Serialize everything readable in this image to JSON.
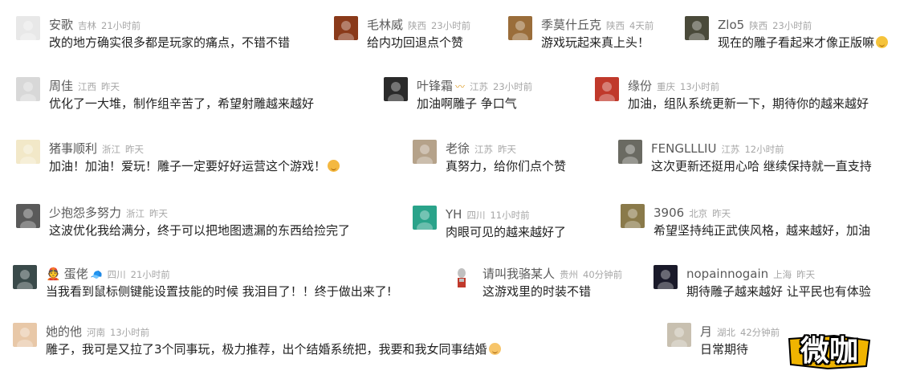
{
  "comments": [
    {
      "name": "安歌",
      "region": "吉林",
      "time": "21小时前",
      "text": "改的地方确实很多都是玩家的痛点，不错不错",
      "avatar_color": "#e8e8e8",
      "avatar_icon": "user-photo-icon"
    },
    {
      "name": "毛林威",
      "region": "陕西",
      "time": "23小时前",
      "text": "给内功回退点个赞",
      "avatar_color": "#8a3a1a",
      "avatar_icon": "user-photo-icon"
    },
    {
      "name": "季莫什丘克",
      "region": "陕西",
      "time": "4天前",
      "text": "游戏玩起来真上头！",
      "avatar_color": "#9a6d3a",
      "avatar_icon": "user-photo-icon"
    },
    {
      "name": "Zlo5",
      "region": "陕西",
      "time": "23小时前",
      "text": "现在的雕子看起来才像正版嘛",
      "avatar_color": "#4a4a3a",
      "avatar_icon": "user-photo-icon",
      "emoji": "wink-emoji-icon"
    },
    {
      "name": "周佳",
      "region": "江西",
      "time": "昨天",
      "text": "优化了一大堆，制作组辛苦了，希望射雕越来越好",
      "avatar_color": "#d8d8d8",
      "avatar_icon": "user-photo-icon"
    },
    {
      "name": "叶锋霜",
      "region": "江苏",
      "time": "23小时前",
      "text": "加油啊雕子 争口气",
      "avatar_color": "#2a2a2a",
      "avatar_icon": "user-photo-icon",
      "badge": "〰"
    },
    {
      "name": "缘份",
      "region": "重庆",
      "time": "13小时前",
      "text": "加油，组队系统更新一下，期待你的越来越好",
      "avatar_color": "#c0392b",
      "avatar_icon": "user-photo-icon"
    },
    {
      "name": "猪事顺利",
      "region": "浙江",
      "time": "昨天",
      "text": "加油！加油！爱玩！雕子一定要好好运营这个游戏！",
      "avatar_color": "#f2e8c8",
      "avatar_icon": "user-photo-icon",
      "emoji": "happy-emoji-icon"
    },
    {
      "name": "老徐",
      "region": "江苏",
      "time": "昨天",
      "text": "真努力，给你们点个赞",
      "avatar_color": "#b5a28a",
      "avatar_icon": "user-photo-icon"
    },
    {
      "name": "FENGLLLIU",
      "region": "江苏",
      "time": "12小时前",
      "text": "这次更新还挺用心哈 继续保持就一直支持",
      "avatar_color": "#6a6a62",
      "avatar_icon": "user-photo-icon"
    },
    {
      "name": "少抱怨多努力",
      "region": "浙江",
      "time": "昨天",
      "text": "这波优化我给满分，终于可以把地图遗漏的东西给捡完了",
      "avatar_color": "#5a5a5a",
      "avatar_icon": "user-photo-icon"
    },
    {
      "name": "YH",
      "region": "四川",
      "time": "11小时前",
      "text": "肉眼可见的越来越好了",
      "avatar_color": "#2aa38a",
      "avatar_icon": "user-photo-icon"
    },
    {
      "name": "3906",
      "region": "北京",
      "time": "昨天",
      "text": "希望坚持纯正武侠风格，越来越好，加油",
      "avatar_color": "#8a7a4a",
      "avatar_icon": "user-photo-icon"
    },
    {
      "name": "蛋佬",
      "region": "四川",
      "time": "21小时前",
      "text": "当我看到鼠标侧键能设置技能的时候 我泪目了！！终于做出来了!",
      "avatar_color": "#3a4a4a",
      "avatar_icon": "user-photo-icon",
      "prefix": "👲",
      "badge": "🧢"
    },
    {
      "name": "请叫我骆某人",
      "region": "贵州",
      "time": "40分钟前",
      "text": "这游戏里的时装不错",
      "avatar_color": "#ffffff",
      "avatar_icon": "ultraman-icon"
    },
    {
      "name": "nopainnogain",
      "region": "上海",
      "time": "昨天",
      "text": "期待雕子越来越好 让平民也有体验",
      "avatar_color": "#1a1a2a",
      "avatar_icon": "user-photo-icon"
    },
    {
      "name": "她的他",
      "region": "河南",
      "time": "13小时前",
      "text": "雕子，我可是又拉了3个同事玩，极力推荐，出个结婚系统把，我要和我女同事结婚",
      "avatar_color": "#e8c8a8",
      "avatar_icon": "user-photo-icon",
      "emoji": "shy-emoji-icon"
    },
    {
      "name": "月",
      "region": "湖北",
      "time": "42分钟前",
      "text": "日常期待",
      "avatar_color": "#c8c0b0",
      "avatar_icon": "user-photo-icon"
    }
  ],
  "watermark": {
    "text": "微咖",
    "color": "#f0b400"
  }
}
